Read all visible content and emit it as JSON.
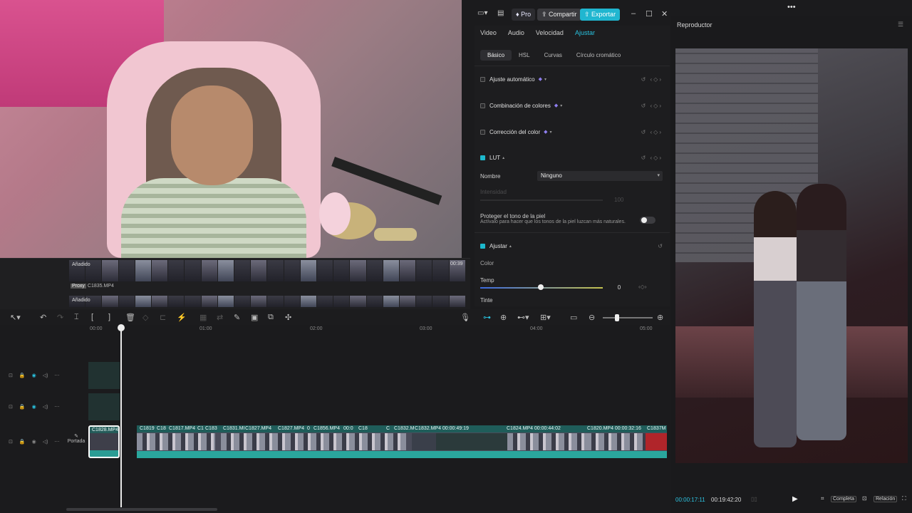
{
  "top_bar": {
    "pro_label": "Pro",
    "share_label": "Compartir",
    "export_label": "Exportar"
  },
  "media_strip": {
    "row1_label": "Añadido",
    "row1_duration": "00:39",
    "proxy_badge": "Proxy",
    "proxy_file": "C1835.MP4",
    "row2_label": "Añadido"
  },
  "properties": {
    "main_tabs": [
      "Video",
      "Audio",
      "Velocidad",
      "Ajustar"
    ],
    "active_main_tab": "Ajustar",
    "sub_tabs": [
      "Básico",
      "HSL",
      "Curvas",
      "Círculo cromático"
    ],
    "active_sub_tab": "Básico",
    "sections": {
      "auto_adjust": "Ajuste automático",
      "color_combo": "Combinación de colores",
      "color_correction": "Corrección del color",
      "lut": "LUT",
      "adjust": "Ajustar"
    },
    "lut_name_label": "Nombre",
    "lut_name_value": "Ninguno",
    "intensity_label": "Intensidad",
    "intensity_value": "100",
    "skin_title": "Proteger el tono de la piel",
    "skin_desc": "Actívalo para hacer que los tonos de la piel luzcan más naturales.",
    "color_heading": "Color",
    "temp_label": "Temp",
    "temp_value": "0",
    "tint_label": "Tinte"
  },
  "player": {
    "title": "Reproductor",
    "current_time": "00:00:17:11",
    "total_time": "00:19:42:20",
    "complete_label": "Completa",
    "ratio_label": "Relación"
  },
  "timeline": {
    "ruler_labels": [
      "00:00",
      "01:00",
      "02:00",
      "03:00",
      "04:00",
      "05:00"
    ],
    "portada_label": "Portada",
    "clip_names": [
      "C1828.MP4",
      "C1819",
      "C18",
      "C1817.MP4",
      "C1",
      "C183",
      "C1831.MI",
      "C1827.MP4",
      "C1827.MP4",
      "0",
      "C1856.MP4",
      "00:0",
      "C18",
      "C",
      "C1832.M",
      "C1832.MP4  00:00:49:19",
      "C1824.MP4  00:00:44:02",
      "C1820.MP4  00:00:32:16",
      "C1837M"
    ]
  },
  "colors": {
    "accent": "#29c1de",
    "export": "#20b6d0",
    "clip_teal": "#2aa69d"
  }
}
